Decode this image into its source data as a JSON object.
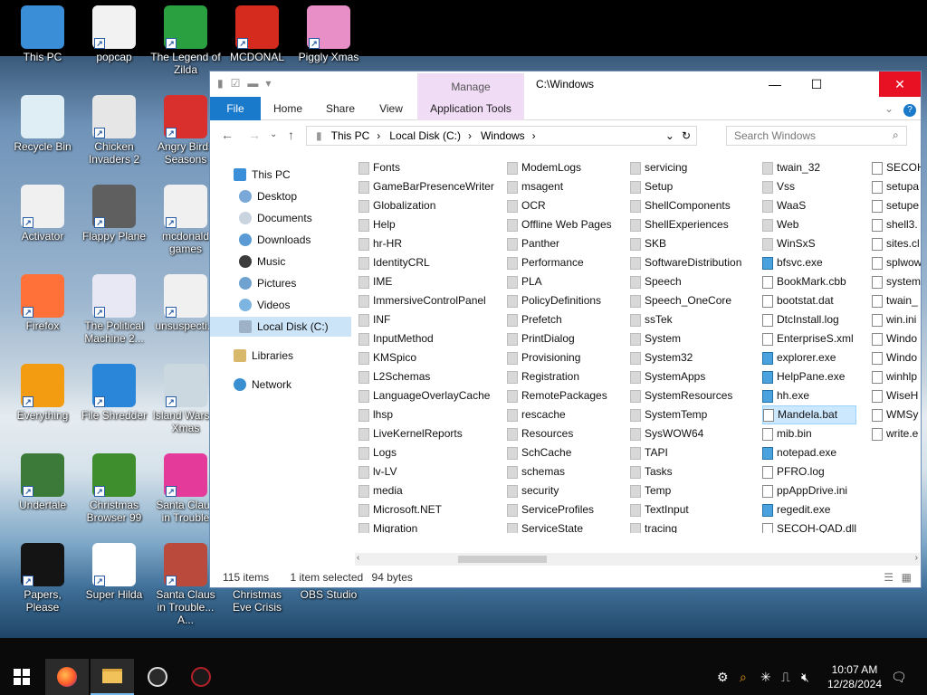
{
  "desktop": {
    "icons": [
      {
        "label": "This PC"
      },
      {
        "label": "popcap"
      },
      {
        "label": "The Legend of Zilda"
      },
      {
        "label": "MCDONAL"
      },
      {
        "label": "Piggly Xmas"
      },
      {
        "label": "Recycle Bin"
      },
      {
        "label": "Chicken Invaders 2"
      },
      {
        "label": "Angry Birds Seasons"
      },
      {
        "label": "Activator"
      },
      {
        "label": "Flappy Plane"
      },
      {
        "label": "mcdonald games"
      },
      {
        "label": "Firefox"
      },
      {
        "label": "The Political Machine 2..."
      },
      {
        "label": "unsuspecti..."
      },
      {
        "label": "Everything"
      },
      {
        "label": "File Shredder"
      },
      {
        "label": "Island Wars 2 Xmas"
      },
      {
        "label": "Undertale"
      },
      {
        "label": "Christmas Browser 99"
      },
      {
        "label": "Santa Claus in Trouble"
      },
      {
        "label": "Papers, Please"
      },
      {
        "label": "Super Hilda"
      },
      {
        "label": "Santa Claus in Trouble... A..."
      },
      {
        "label": "Christmas Eve Crisis"
      },
      {
        "label": "OBS Studio"
      }
    ]
  },
  "explorer": {
    "title": "C:\\Windows",
    "context_tab": "Manage",
    "tabs": {
      "file": "File",
      "home": "Home",
      "share": "Share",
      "view": "View",
      "app_tools": "Application Tools"
    },
    "breadcrumb": [
      "This PC",
      "Local Disk (C:)",
      "Windows"
    ],
    "search_placeholder": "Search Windows",
    "nav": {
      "this_pc": "This PC",
      "desktop": "Desktop",
      "documents": "Documents",
      "downloads": "Downloads",
      "music": "Music",
      "pictures": "Pictures",
      "videos": "Videos",
      "local_disk": "Local Disk (C:)",
      "libraries": "Libraries",
      "network": "Network"
    },
    "columns": [
      [
        "Fonts",
        "GameBarPresenceWriter",
        "Globalization",
        "Help",
        "hr-HR",
        "IdentityCRL",
        "IME",
        "ImmersiveControlPanel",
        "INF",
        "InputMethod",
        "KMSpico",
        "L2Schemas",
        "LanguageOverlayCache",
        "lhsp",
        "LiveKernelReports",
        "Logs",
        "lv-LV",
        "media",
        "Microsoft.NET",
        "Migration"
      ],
      [
        "ModemLogs",
        "msagent",
        "OCR",
        "Offline Web Pages",
        "Panther",
        "Performance",
        "PLA",
        "PolicyDefinitions",
        "Prefetch",
        "PrintDialog",
        "Provisioning",
        "Registration",
        "RemotePackages",
        "rescache",
        "Resources",
        "SchCache",
        "schemas",
        "security",
        "ServiceProfiles",
        "ServiceState"
      ],
      [
        "servicing",
        "Setup",
        "ShellComponents",
        "ShellExperiences",
        "SKB",
        "SoftwareDistribution",
        "Speech",
        "Speech_OneCore",
        "ssTek",
        "System",
        "System32",
        "SystemApps",
        "SystemResources",
        "SystemTemp",
        "SysWOW64",
        "TAPI",
        "Tasks",
        "Temp",
        "TextInput",
        "tracing"
      ],
      [
        "twain_32",
        "Vss",
        "WaaS",
        "Web",
        "WinSxS",
        "bfsvc.exe",
        "BookMark.cbb",
        "bootstat.dat",
        "DtcInstall.log",
        "EnterpriseS.xml",
        "explorer.exe",
        "HelpPane.exe",
        "hh.exe",
        "Mandela.bat",
        "mib.bin",
        "notepad.exe",
        "PFRO.log",
        "ppAppDrive.ini",
        "regedit.exe",
        "SECOH-QAD.dll"
      ],
      [
        "SECOH",
        "setupa",
        "setupe",
        "shell3.",
        "sites.cl",
        "splwow",
        "system",
        "twain_",
        "win.ini",
        "Windo",
        "Windo",
        "winhlp",
        "WiseH",
        "WMSy",
        "write.e"
      ]
    ],
    "selected_item": "Mandela.bat",
    "status": {
      "count": "115 items",
      "selected": "1 item selected",
      "size": "94 bytes"
    }
  },
  "taskbar": {
    "time": "10:07 AM",
    "date": "12/28/2024"
  }
}
